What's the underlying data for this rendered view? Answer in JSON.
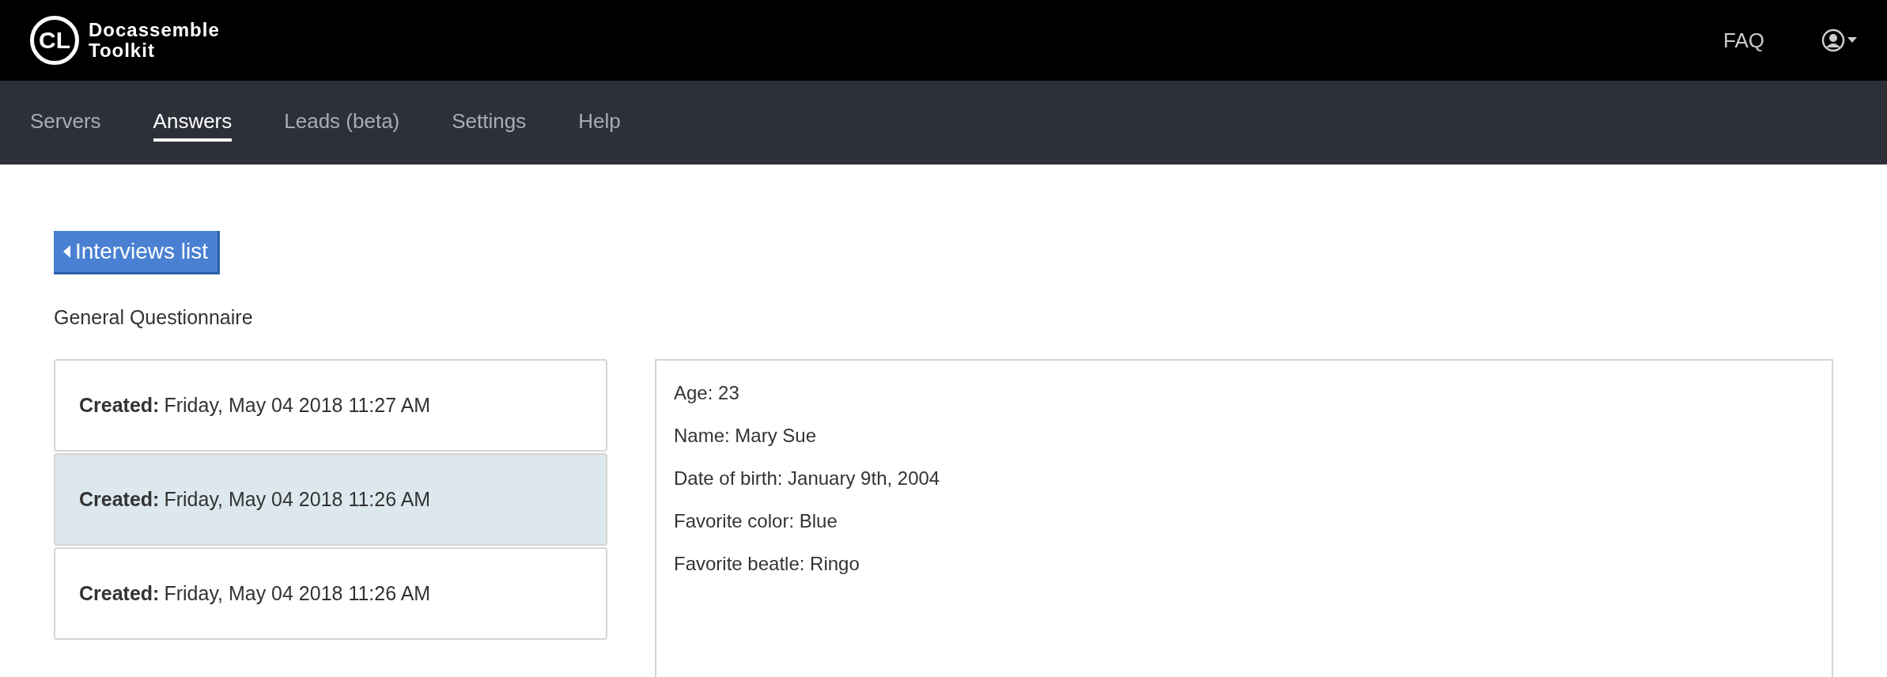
{
  "header": {
    "logo_mark": "CL",
    "logo_text": [
      "Docassemble",
      "Toolkit"
    ],
    "links": [
      "FAQ"
    ]
  },
  "nav": [
    {
      "label": "Servers",
      "selected": false
    },
    {
      "label": "Answers",
      "selected": true
    },
    {
      "label": "Leads (beta)",
      "selected": false
    },
    {
      "label": "Settings",
      "selected": false
    },
    {
      "label": "Help",
      "selected": false
    }
  ],
  "back_button": {
    "label": "Interviews list"
  },
  "interview_title": "General Questionnaire",
  "sessions": [
    {
      "label": "Created:",
      "value": "Friday, May 04 2018 11:27 AM",
      "selected": false
    },
    {
      "label": "Created:",
      "value": "Friday, May 04 2018 11:26 AM",
      "selected": true
    },
    {
      "label": "Created:",
      "value": "Friday, May 04 2018 11:26 AM",
      "selected": false
    }
  ],
  "answers": [
    "Age: 23",
    "Name: Mary Sue",
    "Date of birth: January 9th, 2004",
    "Favorite color: Blue",
    "Favorite beatle: Ringo"
  ]
}
